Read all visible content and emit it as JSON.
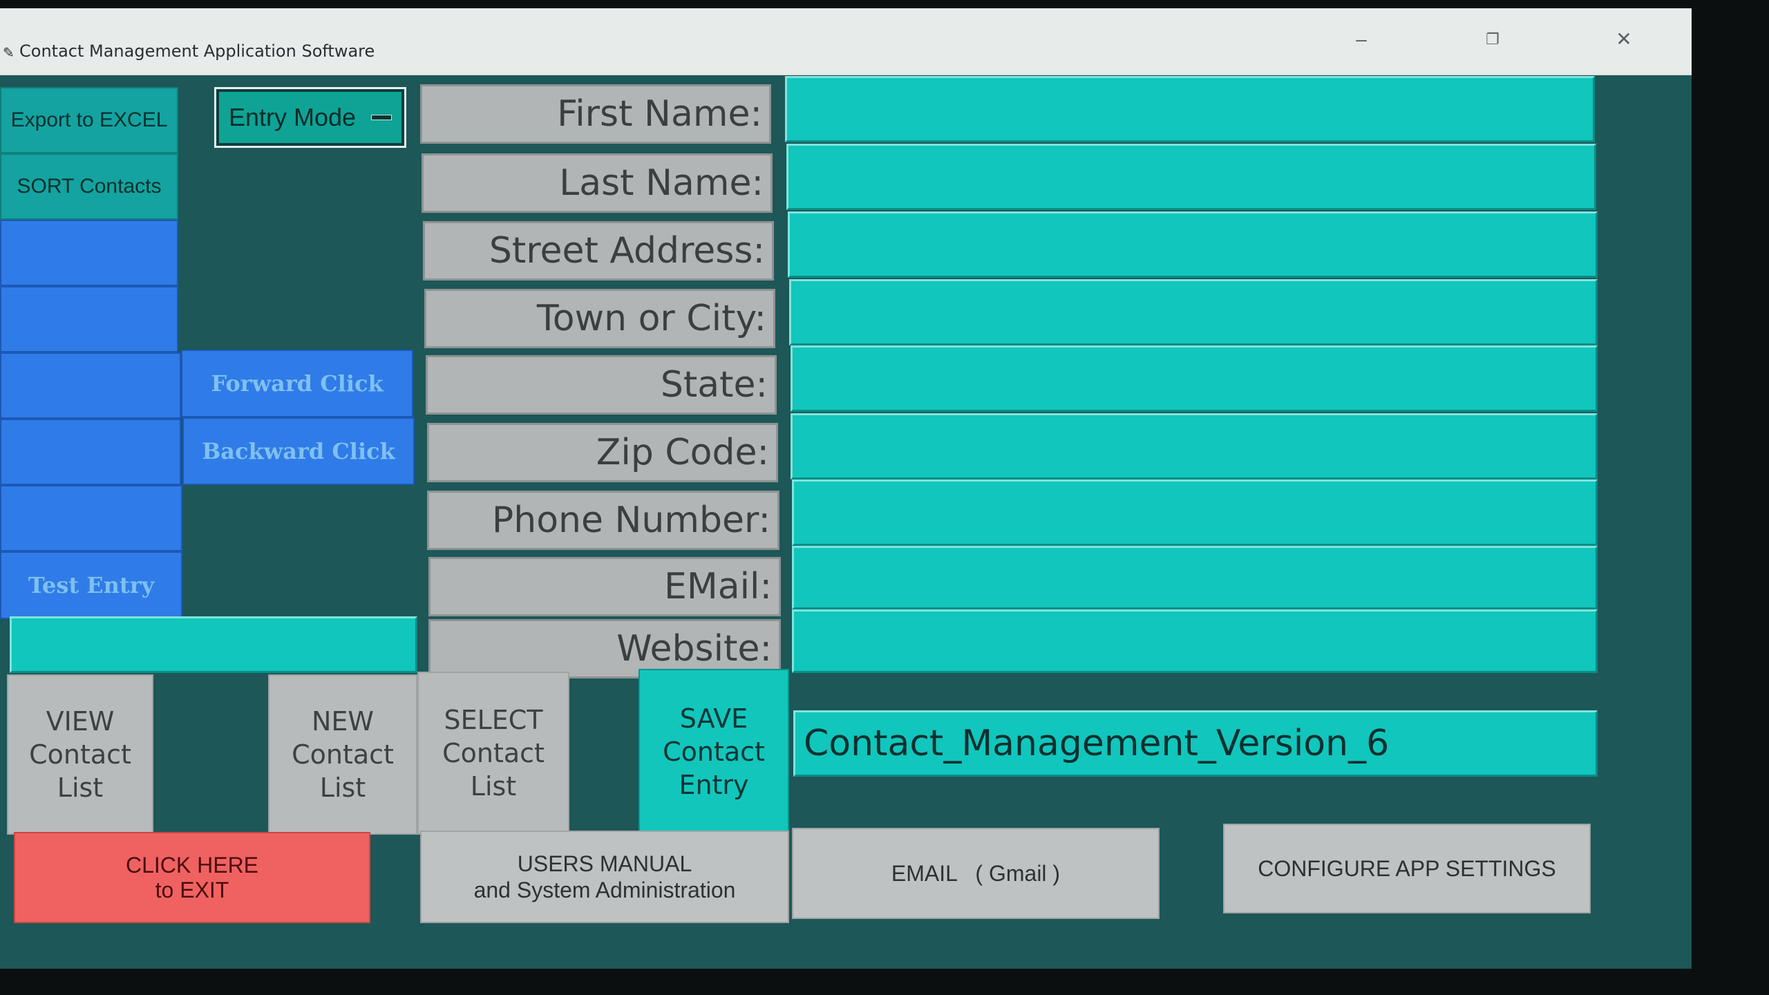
{
  "window": {
    "title": "Contact Management Application Software",
    "controls": {
      "minimize": "–",
      "restore": "❐",
      "close": "✕"
    }
  },
  "sidebar": {
    "export_label": "Export to EXCEL",
    "sort_label": "SORT Contacts",
    "test_entry_label": "Test Entry"
  },
  "mode": {
    "selected": "Entry Mode"
  },
  "navigation": {
    "forward_label": "Forward Click",
    "backward_label": "Backward Click"
  },
  "form": {
    "labels": {
      "first_name": "First Name:",
      "last_name": "Last Name:",
      "street_address": "Street Address:",
      "town_or_city": "Town or City:",
      "state": "State:",
      "zip_code": "Zip Code:",
      "phone_number": "Phone Number:",
      "email": "EMail:",
      "website": "Website:"
    },
    "values": {
      "first_name": "",
      "last_name": "",
      "street_address": "",
      "town_or_city": "",
      "state": "",
      "zip_code": "",
      "phone_number": "",
      "email": "",
      "website": ""
    },
    "filename": "Contact_Management_Version_6"
  },
  "actions": {
    "view_list": "VIEW\nContact\nList",
    "new_list": "NEW\nContact\nList",
    "select_list": "SELECT\nContact\nList",
    "save_entry": "SAVE\nContact\nEntry",
    "exit": "CLICK HERE\nto EXIT",
    "users_manual": "USERS MANUAL\nand System Administration",
    "email_gmail": "EMAIL   ( Gmail )",
    "configure": "CONFIGURE APP SETTINGS"
  },
  "colors": {
    "background": "#1d5758",
    "field": "#11c6bc",
    "sidebar_blue": "#2f7be8",
    "exit_red": "#f06262",
    "label_gray": "#b1b5b5"
  }
}
